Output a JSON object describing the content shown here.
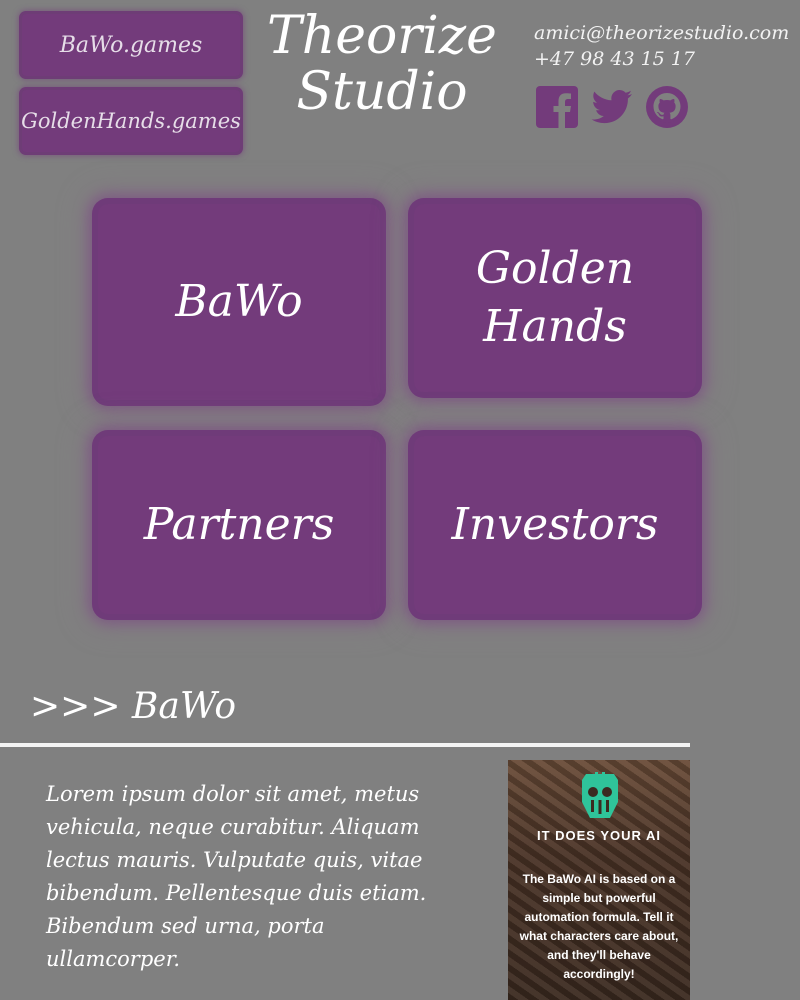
{
  "header": {
    "links": [
      {
        "label": "BaWo.games"
      },
      {
        "label": "GoldenHands.games"
      }
    ],
    "title_line1": "Theorize",
    "title_line2": "Studio",
    "contact": {
      "email": "amici@theorizestudio.com",
      "phone": "+47 98 43 15 17"
    },
    "social": [
      "facebook-icon",
      "twitter-icon",
      "github-icon"
    ]
  },
  "tiles": [
    {
      "line1": "BaWo",
      "line2": ""
    },
    {
      "line1": "Golden",
      "line2": "Hands"
    },
    {
      "line1": "Partners",
      "line2": ""
    },
    {
      "line1": "Investors",
      "line2": ""
    }
  ],
  "section": {
    "heading": ">>> BaWo",
    "body": "Lorem ipsum dolor sit amet, metus vehicula, neque curabitur. Aliquam lectus mauris. Vulputate quis, vitae bibendum. Pellentesque duis etiam. Bibendum sed urna, porta ullamcorper."
  },
  "promo": {
    "heading": "IT DOES YOUR AI",
    "text": "The BaWo AI is based on a simple but powerful automation formula. Tell it what characters care about, and they'll behave accordingly!"
  },
  "colors": {
    "background": "#808080",
    "accent_purple": "#733b7b",
    "promo_logo": "#2fc49a"
  }
}
